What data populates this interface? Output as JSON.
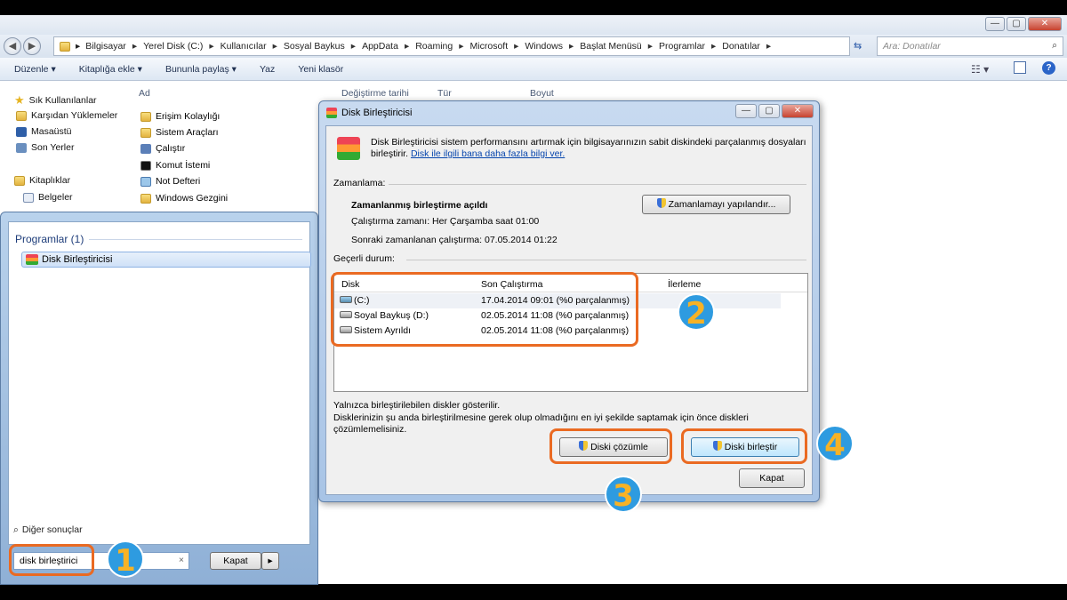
{
  "explorer": {
    "title_buttons": {
      "minimize": "—",
      "maximize": "▢",
      "close": "✕"
    },
    "breadcrumb": [
      "Bilgisayar",
      "Yerel Disk (C:)",
      "Kullanıcılar",
      "Sosyal Baykus",
      "AppData",
      "Roaming",
      "Microsoft",
      "Windows",
      "Başlat Menüsü",
      "Programlar",
      "Donatılar"
    ],
    "search_placeholder": "Ara: Donatılar",
    "toolbar": [
      "Düzenle ▾",
      "Kitaplığa ekle ▾",
      "Bununla paylaş ▾",
      "Yaz",
      "Yeni klasör"
    ],
    "sidebar": {
      "favorites_title": "Sık Kullanılanlar",
      "favorites": [
        "Karşıdan Yüklemeler",
        "Masaüstü",
        "Son Yerler"
      ],
      "libraries_title": "Kitaplıklar",
      "libraries": [
        "Belgeler"
      ]
    },
    "columns": [
      "Ad",
      "Değiştirme tarihi",
      "Tür",
      "Boyut"
    ],
    "files": [
      "Erişim Kolaylığı",
      "Sistem Araçları",
      "Çalıştır",
      "Komut İstemi",
      "Not Defteri",
      "Windows Gezgini"
    ]
  },
  "start_menu": {
    "section_title": "Programlar (1)",
    "result": "Disk Birleştiricisi",
    "other_results": "Diğer sonuçlar",
    "search_value": "disk birleştirici",
    "clear": "×",
    "shutdown_label": "Kapat",
    "shutdown_arrow": "▸"
  },
  "dialog": {
    "title": "Disk Birleştiricisi",
    "intro": "Disk Birleştiricisi sistem performansını artırmak için bilgisayarınızın sabit diskindeki parçalanmış dosyaları birleştirir.",
    "intro_link": "Disk ile ilgili bana daha fazla bilgi ver.",
    "schedule_label": "Zamanlama:",
    "schedule_status": "Zamanlanmış birleştirme açıldı",
    "run_time": "Çalıştırma zamanı: Her Çarşamba saat 01:00",
    "next_run": "Sonraki zamanlanan çalıştırma: 07.05.2014 01:22",
    "configure_button": "Zamanlamayı yapılandır...",
    "status_label": "Geçerli durum:",
    "columns": [
      "Disk",
      "Son Çalıştırma",
      "İlerleme"
    ],
    "disks": [
      {
        "name": "(C:)",
        "last_run": "17.04.2014 09:01 (%0 parçalanmış)"
      },
      {
        "name": "Soyal Baykuş (D:)",
        "last_run": "02.05.2014 11:08 (%0 parçalanmış)"
      },
      {
        "name": "Sistem Ayrıldı",
        "last_run": "02.05.2014 11:08 (%0 parçalanmış)"
      }
    ],
    "note1": "Yalnızca birleştirilebilen diskler gösterilir.",
    "note2": "Disklerinizin şu anda birleştirilmesine gerek olup olmadığını en iyi şekilde saptamak için önce diskleri çözümlemelisiniz.",
    "analyze_button": "Diski çözümle",
    "defrag_button": "Diski birleştir",
    "close_button": "Kapat"
  },
  "annotations": {
    "step1": "1",
    "step2": "2",
    "step3": "3",
    "step4": "4",
    "accent": "#ea6a22",
    "badge_color": "#2e9be0"
  }
}
